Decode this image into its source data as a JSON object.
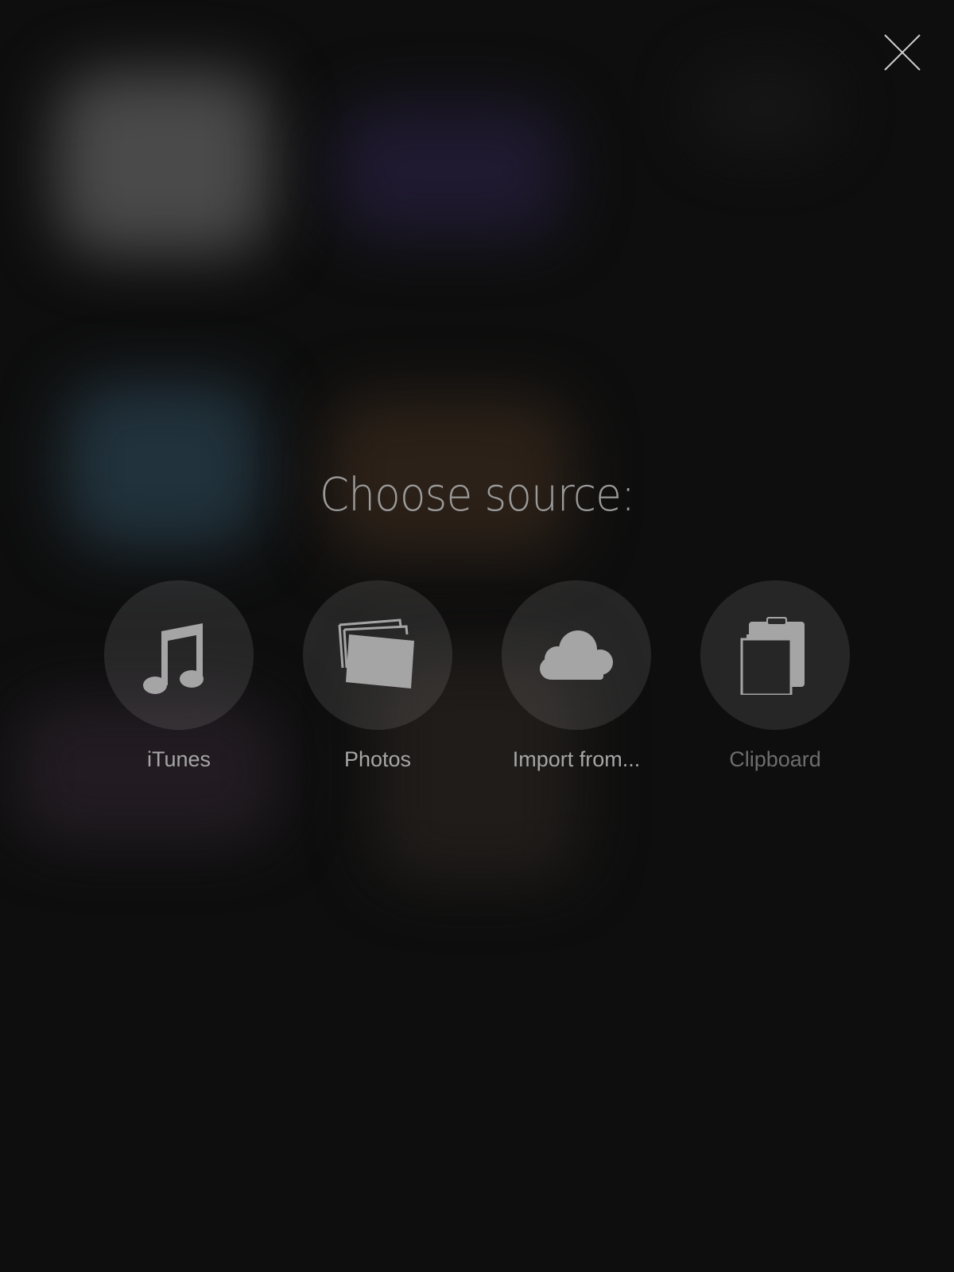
{
  "dialog": {
    "title": "Choose source:",
    "close_icon": "close-icon"
  },
  "sources": [
    {
      "label": "iTunes",
      "icon": "music-note-icon",
      "enabled": true
    },
    {
      "label": "Photos",
      "icon": "photos-icon",
      "enabled": true
    },
    {
      "label": "Import from...",
      "icon": "cloud-icon",
      "enabled": true
    },
    {
      "label": "Clipboard",
      "icon": "clipboard-icon",
      "enabled": false
    }
  ],
  "colors": {
    "background": "#0e0e0e",
    "icon": "#a5a5a5",
    "label": "#a6a6a6",
    "label_disabled": "#6d6d6d"
  }
}
